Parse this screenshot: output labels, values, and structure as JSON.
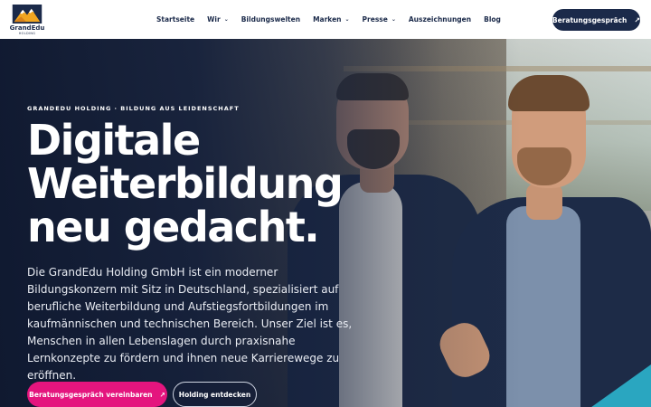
{
  "brand": {
    "name": "GrandEdu",
    "tagline": "HOLDING"
  },
  "nav": {
    "items": [
      {
        "label": "Startseite",
        "has_dropdown": false
      },
      {
        "label": "Wir",
        "has_dropdown": true
      },
      {
        "label": "Bildungswelten",
        "has_dropdown": false
      },
      {
        "label": "Marken",
        "has_dropdown": true
      },
      {
        "label": "Presse",
        "has_dropdown": true
      },
      {
        "label": "Auszeichnungen",
        "has_dropdown": false
      },
      {
        "label": "Blog",
        "has_dropdown": false
      }
    ],
    "chevron": "⌄",
    "cta_label": "Beratungsgespräch",
    "cta_icon": "↗"
  },
  "hero": {
    "eyebrow": "GRANDEDU HOLDING · BILDUNG AUS LEIDENSCHAFT",
    "headline": [
      "Digitale",
      "Weiterbildung",
      "neu gedacht."
    ],
    "body": "Die GrandEdu Holding GmbH ist ein moderner Bildungskonzern mit Sitz in Deutschland, spezialisiert auf berufliche Weiterbildung und Aufstiegsfortbildungen im kaufmännischen und technischen Bereich. Unser Ziel ist es, Menschen in allen Lebenslagen durch praxisnahe Lernkonzepte zu fördern und ihnen neue Karrierewege zu eröffnen.",
    "primary_button": "Beratungsgespräch vereinbaren",
    "primary_icon": "↗",
    "secondary_button": "Holding entdecken"
  },
  "colors": {
    "navy": "#1b2a4a",
    "accent_pink": "#e4157e",
    "accent_teal": "#2aa6c0"
  }
}
